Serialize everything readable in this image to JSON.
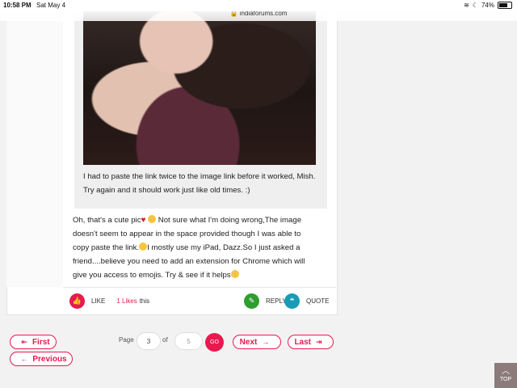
{
  "status_bar": {
    "time": "10:58 PM",
    "date": "Sat May 4",
    "url": "indiaforums.com",
    "battery": "74%",
    "battery_level": 0.74
  },
  "quote": {
    "text": "I had to paste the link twice to the image link before it worked, Mish.  Try again and it should work just like old times. :)"
  },
  "post": {
    "line1a": "Oh, that's a cute pic",
    "line1b": " Not sure what I'm doing wrong,The image",
    "line2": "doesn't seem to appear in the space provided though I was able to",
    "line3a": " copy paste the link.",
    "line3b": "I mostly use my iPad,  Dazz.So I just asked a",
    "line4": "friend....believe you need to add an extension for Chrome which will",
    "line5a": "give you access to emojis. Try & see if it helps"
  },
  "actions": {
    "like": "LIKE",
    "likes_count": "1 Likes",
    "likes_suffix": "this",
    "reply": "REPLY",
    "quote": "QUOTE"
  },
  "pagination": {
    "first": "First",
    "previous": "Previous",
    "page_label": "Page",
    "current_page": "3",
    "of_label": "of",
    "total_pages": "5",
    "go": "GO",
    "next": "Next",
    "last": "Last"
  },
  "top_button": "TOP",
  "colors": {
    "accent": "#e8194f",
    "like": "#e8194f",
    "reply": "#2e9e2e",
    "quote": "#1a9bb5"
  }
}
